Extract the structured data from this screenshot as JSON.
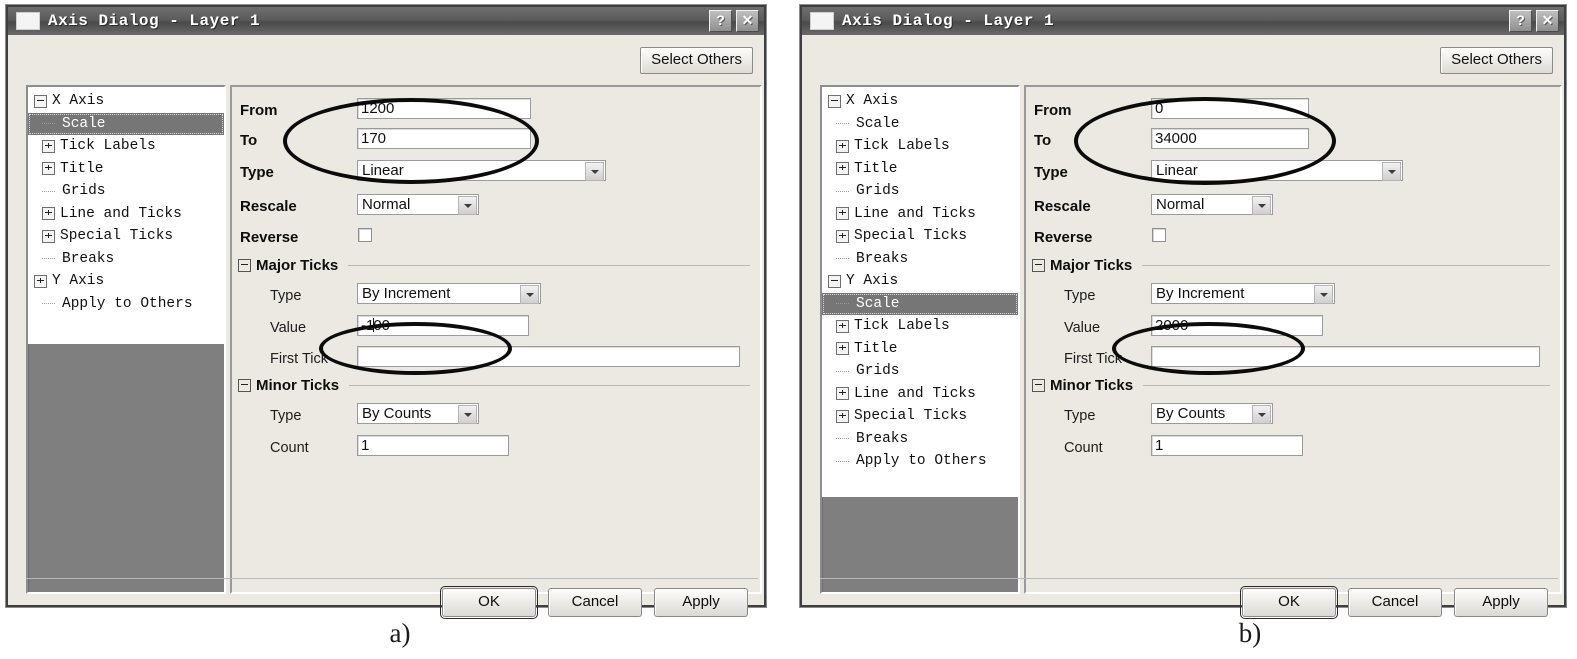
{
  "figure": {
    "caption_a": "a)",
    "caption_b": "b)"
  },
  "dialog_a": {
    "title": "Axis Dialog - Layer 1",
    "title_icon": "window-icon",
    "help_button": "?",
    "close_button": "✕",
    "select_others_label": "Select Others",
    "tree": {
      "items": [
        {
          "label": "X Axis",
          "level": 0,
          "toggle": "minus",
          "selected": false
        },
        {
          "label": "Scale",
          "level": 1,
          "toggle": "none",
          "selected": true
        },
        {
          "label": "Tick Labels",
          "level": 1,
          "toggle": "plus",
          "selected": false
        },
        {
          "label": "Title",
          "level": 1,
          "toggle": "plus",
          "selected": false
        },
        {
          "label": "Grids",
          "level": 1,
          "toggle": "none",
          "selected": false
        },
        {
          "label": "Line and Ticks",
          "level": 1,
          "toggle": "plus",
          "selected": false
        },
        {
          "label": "Special Ticks",
          "level": 1,
          "toggle": "plus",
          "selected": false
        },
        {
          "label": "Breaks",
          "level": 1,
          "toggle": "none",
          "selected": false
        },
        {
          "label": "Y Axis",
          "level": 0,
          "toggle": "plus",
          "selected": false
        },
        {
          "label": "Apply to Others",
          "level": 1,
          "toggle": "none",
          "selected": false
        }
      ]
    },
    "scale": {
      "from_label": "From",
      "from_value": "1200",
      "to_label": "To",
      "to_value": "170",
      "type_label": "Type",
      "type_value": "Linear",
      "rescale_label": "Rescale",
      "rescale_value": "Normal",
      "reverse_label": "Reverse",
      "reverse_checked": false
    },
    "major_ticks": {
      "group_label": "Major Ticks",
      "type_label": "Type",
      "type_value": "By Increment",
      "value_label": "Value",
      "value_value": "-100",
      "first_tick_label": "First Tick",
      "first_tick_value": ""
    },
    "minor_ticks": {
      "group_label": "Minor Ticks",
      "type_label": "Type",
      "type_value": "By Counts",
      "count_label": "Count",
      "count_value": "1"
    },
    "buttons": {
      "ok": "OK",
      "cancel": "Cancel",
      "apply": "Apply"
    }
  },
  "dialog_b": {
    "title": "Axis Dialog - Layer 1",
    "title_icon": "window-icon",
    "help_button": "?",
    "close_button": "✕",
    "select_others_label": "Select Others",
    "tree": {
      "items": [
        {
          "label": "X Axis",
          "level": 0,
          "toggle": "minus",
          "selected": false
        },
        {
          "label": "Scale",
          "level": 1,
          "toggle": "none",
          "selected": false
        },
        {
          "label": "Tick Labels",
          "level": 1,
          "toggle": "plus",
          "selected": false
        },
        {
          "label": "Title",
          "level": 1,
          "toggle": "plus",
          "selected": false
        },
        {
          "label": "Grids",
          "level": 1,
          "toggle": "none",
          "selected": false
        },
        {
          "label": "Line and Ticks",
          "level": 1,
          "toggle": "plus",
          "selected": false
        },
        {
          "label": "Special Ticks",
          "level": 1,
          "toggle": "plus",
          "selected": false
        },
        {
          "label": "Breaks",
          "level": 1,
          "toggle": "none",
          "selected": false
        },
        {
          "label": "Y Axis",
          "level": 0,
          "toggle": "minus",
          "selected": false
        },
        {
          "label": "Scale",
          "level": 1,
          "toggle": "none",
          "selected": true
        },
        {
          "label": "Tick Labels",
          "level": 1,
          "toggle": "plus",
          "selected": false
        },
        {
          "label": "Title",
          "level": 1,
          "toggle": "plus",
          "selected": false
        },
        {
          "label": "Grids",
          "level": 1,
          "toggle": "none",
          "selected": false
        },
        {
          "label": "Line and Ticks",
          "level": 1,
          "toggle": "plus",
          "selected": false
        },
        {
          "label": "Special Ticks",
          "level": 1,
          "toggle": "plus",
          "selected": false
        },
        {
          "label": "Breaks",
          "level": 1,
          "toggle": "none",
          "selected": false
        },
        {
          "label": "Apply to Others",
          "level": 1,
          "toggle": "none",
          "selected": false
        }
      ]
    },
    "scale": {
      "from_label": "From",
      "from_value": "0",
      "to_label": "To",
      "to_value": "34000",
      "type_label": "Type",
      "type_value": "Linear",
      "rescale_label": "Rescale",
      "rescale_value": "Normal",
      "reverse_label": "Reverse",
      "reverse_checked": false
    },
    "major_ticks": {
      "group_label": "Major Ticks",
      "type_label": "Type",
      "type_value": "By Increment",
      "value_label": "Value",
      "value_value": "2000",
      "first_tick_label": "First Tick",
      "first_tick_value": ""
    },
    "minor_ticks": {
      "group_label": "Minor Ticks",
      "type_label": "Type",
      "type_value": "By Counts",
      "count_label": "Count",
      "count_value": "1"
    },
    "buttons": {
      "ok": "OK",
      "cancel": "Cancel",
      "apply": "Apply"
    }
  },
  "colors": {
    "titlebar": "#5b5b5b",
    "dialog_face": "#ece9e2",
    "tree_fill": "#807f7f",
    "selection": "#767676",
    "annotation": "#0b0b0b"
  }
}
